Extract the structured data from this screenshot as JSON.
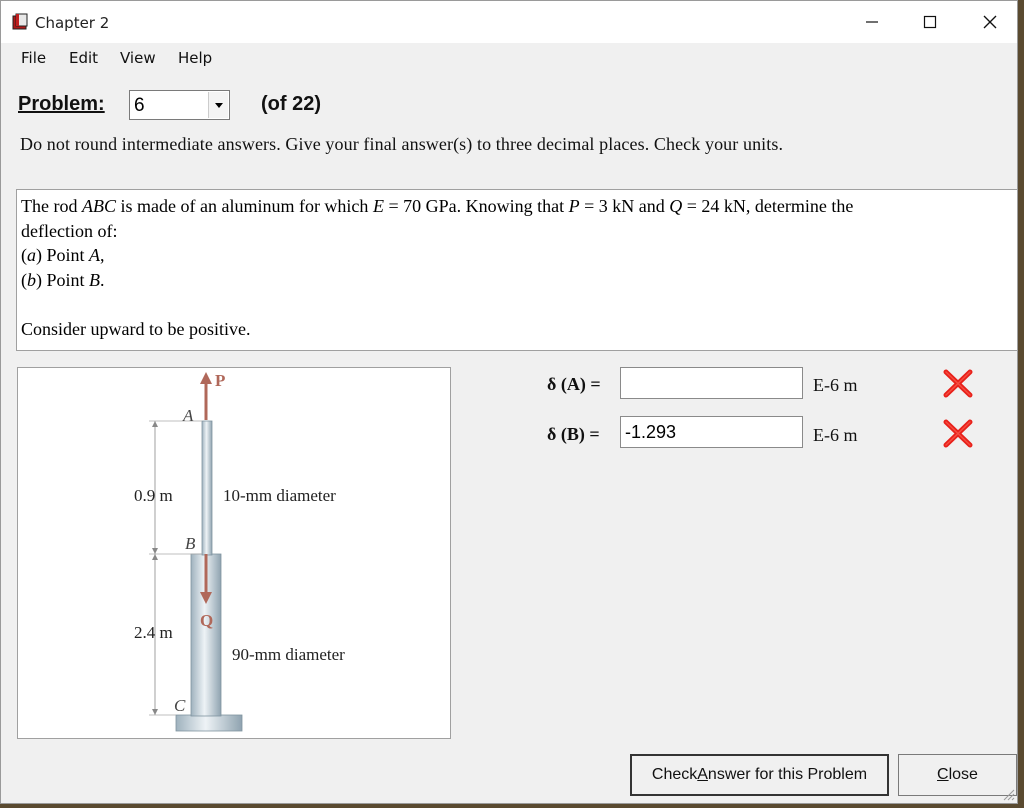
{
  "window": {
    "title": "Chapter 2"
  },
  "menu": [
    "File",
    "Edit",
    "View",
    "Help"
  ],
  "problem": {
    "label": "Problem:",
    "selected": "6",
    "of_text": "(of 22)"
  },
  "instructions": "Do not round intermediate answers.  Give your final answer(s) to three decimal places.  Check your units.",
  "statement": {
    "line1_a": "The rod ",
    "line1_b": "ABC",
    "line1_c": " is made of an aluminum for which ",
    "line1_d": "E",
    "line1_e": " = 70 GPa. Knowing that ",
    "line1_f": "P",
    "line1_g": " = 3 kN and ",
    "line1_h": "Q",
    "line1_i": " = 24 kN, determine the",
    "line2": "deflection of:",
    "part_a_paren": "(",
    "part_a_letter": "a",
    "part_a_rest": ") Point ",
    "part_a_point": "A",
    "part_a_end": ",",
    "part_b_paren": "(",
    "part_b_letter": "b",
    "part_b_rest": ") Point ",
    "part_b_point": "B",
    "part_b_end": ".",
    "note": "Consider upward to be positive."
  },
  "figure": {
    "load_P": "P",
    "load_Q": "Q",
    "point_A": "A",
    "point_B": "B",
    "point_C": "C",
    "length_upper": "0.9 m",
    "length_lower": "2.4 m",
    "diameter_upper": "10-mm diameter",
    "diameter_lower": "90-mm diameter"
  },
  "answers": [
    {
      "label": "δ (A) =",
      "value": "",
      "unit": "E-6 m",
      "status": "incorrect"
    },
    {
      "label": "δ (B) =",
      "value": "-1.293",
      "unit": "E-6 m",
      "status": "incorrect"
    }
  ],
  "buttons": {
    "check_pre": "Check ",
    "check_ul": "A",
    "check_post": "nswer for this Problem",
    "close_ul": "C",
    "close_post": "lose"
  },
  "colors": {
    "incorrect": "#e8201a",
    "arrow": "#b0685a",
    "rod": "#c9d6df"
  }
}
